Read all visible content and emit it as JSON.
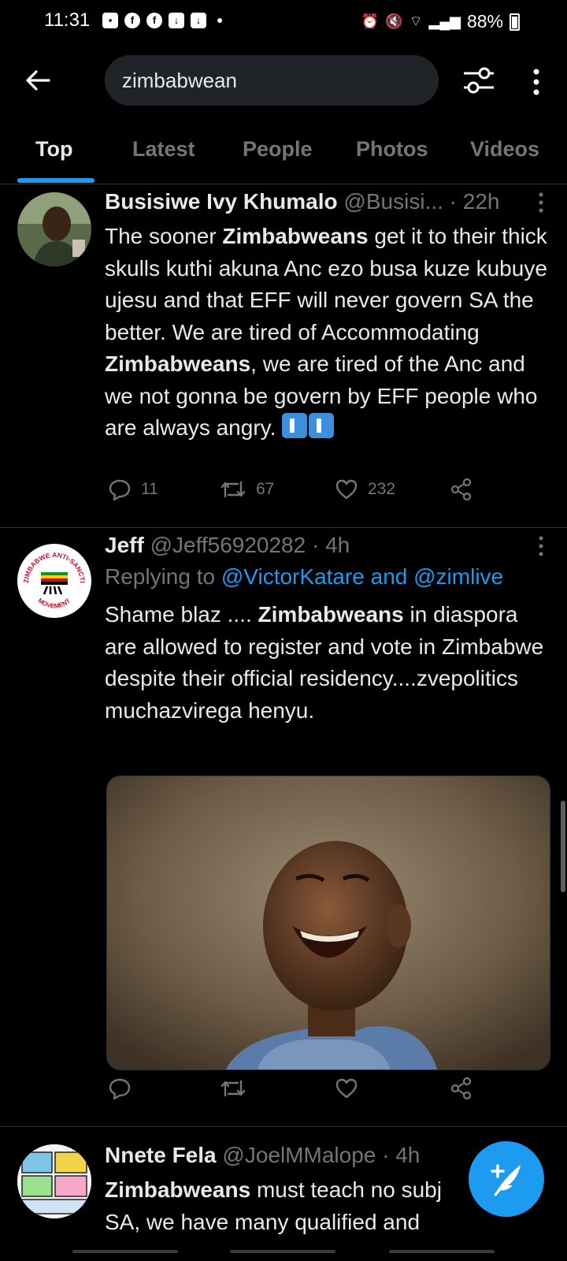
{
  "status_bar": {
    "time": "11:31",
    "battery": "88%"
  },
  "search": {
    "query": "zimbabwean"
  },
  "tabs": [
    {
      "label": "Top",
      "active": true
    },
    {
      "label": "Latest",
      "active": false
    },
    {
      "label": "People",
      "active": false
    },
    {
      "label": "Photos",
      "active": false
    },
    {
      "label": "Videos",
      "active": false
    }
  ],
  "tweets": [
    {
      "name": "Busisiwe Ivy Khumalo",
      "handle": "@Busisi...",
      "time": " · 22h",
      "text_parts": [
        "The sooner ",
        "Zimbabweans",
        " get it to their thick skulls kuthi akuna Anc ezo busa kuze kubuye ujesu and that EFF will never govern SA the better. We are tired of Accommodating ",
        "Zimbabweans",
        ", we are tired of the Anc and we not gonna be govern by EFF people who are always angry. "
      ],
      "replies": "11",
      "retweets": "67",
      "likes": "232"
    },
    {
      "name": "Jeff",
      "handle": "@Jeff56920282",
      "time": " · 4h",
      "replying_prefix": "Replying to ",
      "replying_to": "@VictorKatare and @zimlive",
      "text_parts": [
        "Shame blaz .... ",
        "Zimbabweans",
        " in diaspora are allowed to register and vote in Zimbabwe despite their official residency....zvepolitics muchazvirega henyu."
      ],
      "avatar_logo_top": "ZIMBABWE ANTI-SANCTIONS",
      "avatar_logo_bottom": "MOVEMENT"
    },
    {
      "name": "Nnete Fela",
      "handle": "@JoelMMalope",
      "time": " · 4h",
      "text_parts": [
        "Zimbabweans",
        " must teach no subj",
        "SA, we have many qualified and"
      ]
    }
  ],
  "colors": {
    "accent": "#1d9bf0",
    "background": "#000000",
    "secondary_text": "#71767b"
  }
}
